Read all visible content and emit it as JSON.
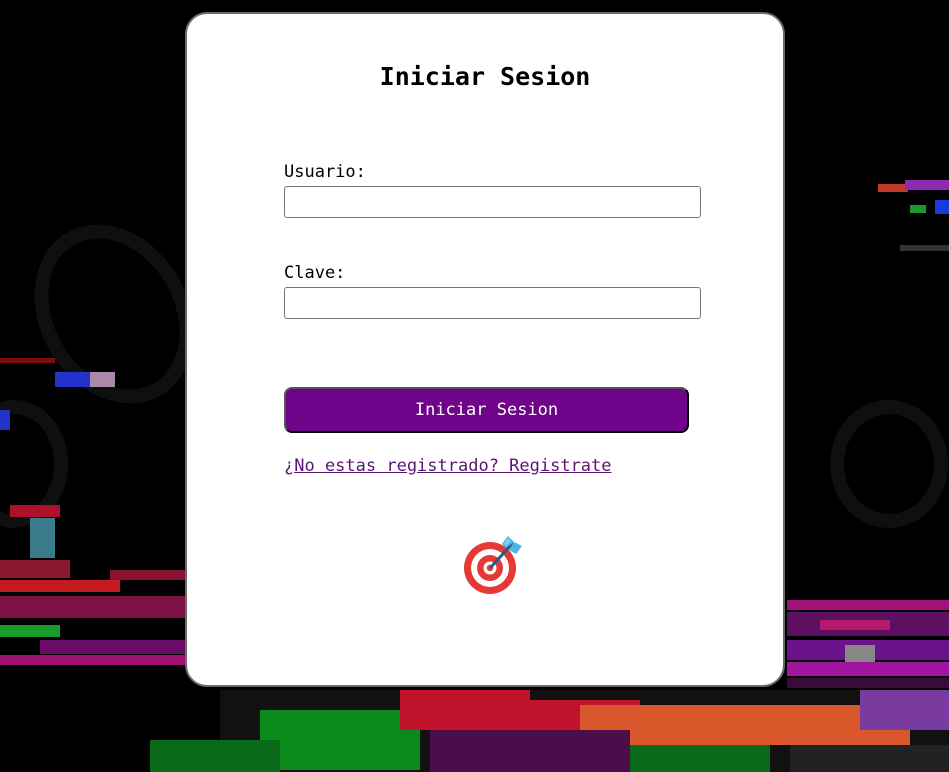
{
  "login": {
    "title": "Iniciar Sesion",
    "username_label": "Usuario:",
    "username_value": "",
    "password_label": "Clave:",
    "password_value": "",
    "submit_label": "Iniciar Sesion",
    "register_link": "¿No estas registrado? Registrate",
    "icon": "target-dart-icon"
  },
  "colors": {
    "button_bg": "#6f0389",
    "link": "#5a1670",
    "page_bg": "#000000"
  }
}
